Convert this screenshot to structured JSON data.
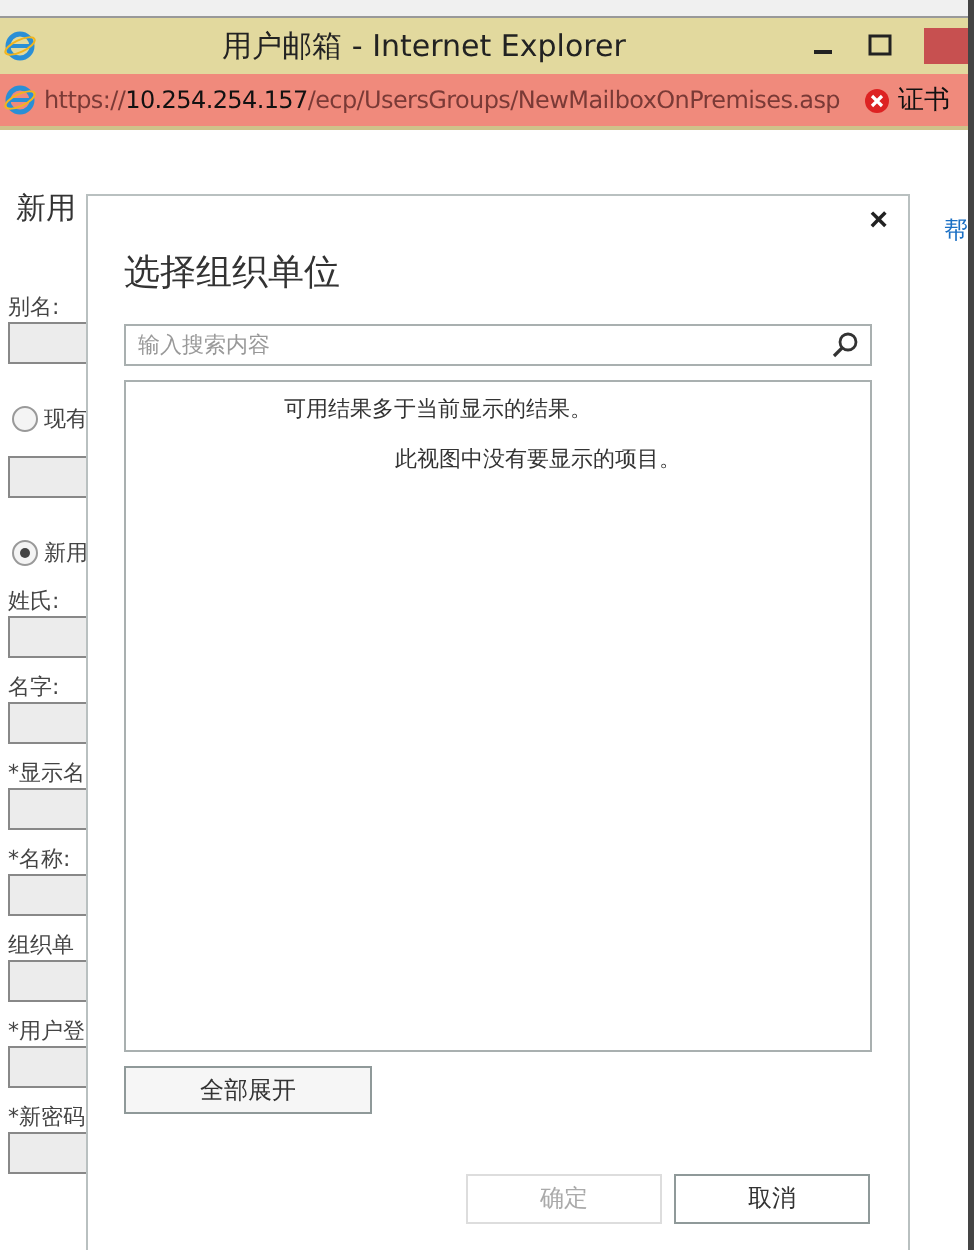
{
  "window": {
    "title": "用户邮箱 - Internet Explorer"
  },
  "address_bar": {
    "url_prefix": "https://",
    "url_host": "10.254.254.157",
    "url_path": "/ecp/UsersGroups/NewMailboxOnPremises.asp",
    "cert_warning": "证书"
  },
  "page": {
    "heading": "新用",
    "help_link": "帮",
    "form": [
      {
        "kind": "label",
        "text": "别名:"
      },
      {
        "kind": "field"
      },
      {
        "kind": "radio",
        "text": "现有",
        "selected": false
      },
      {
        "kind": "field"
      },
      {
        "kind": "radio",
        "text": "新用",
        "selected": true
      },
      {
        "kind": "label",
        "text": "姓氏:"
      },
      {
        "kind": "field"
      },
      {
        "kind": "label",
        "text": "名字:"
      },
      {
        "kind": "field"
      },
      {
        "kind": "label",
        "text": "*显示名"
      },
      {
        "kind": "field"
      },
      {
        "kind": "label",
        "text": "*名称:"
      },
      {
        "kind": "field"
      },
      {
        "kind": "label",
        "text": "组织单"
      },
      {
        "kind": "field"
      },
      {
        "kind": "label",
        "text": "*用户登"
      },
      {
        "kind": "field"
      },
      {
        "kind": "label",
        "text": "*新密码"
      },
      {
        "kind": "field"
      }
    ]
  },
  "dialog": {
    "title": "选择组织单位",
    "close": "×",
    "search": {
      "placeholder": "输入搜索内容"
    },
    "messages": [
      "可用结果多于当前显示的结果。",
      "此视图中没有要显示的项目。"
    ],
    "expand_button": "全部展开",
    "buttons": [
      {
        "label": "确定",
        "disabled": true
      },
      {
        "label": "取消",
        "disabled": false
      }
    ]
  }
}
